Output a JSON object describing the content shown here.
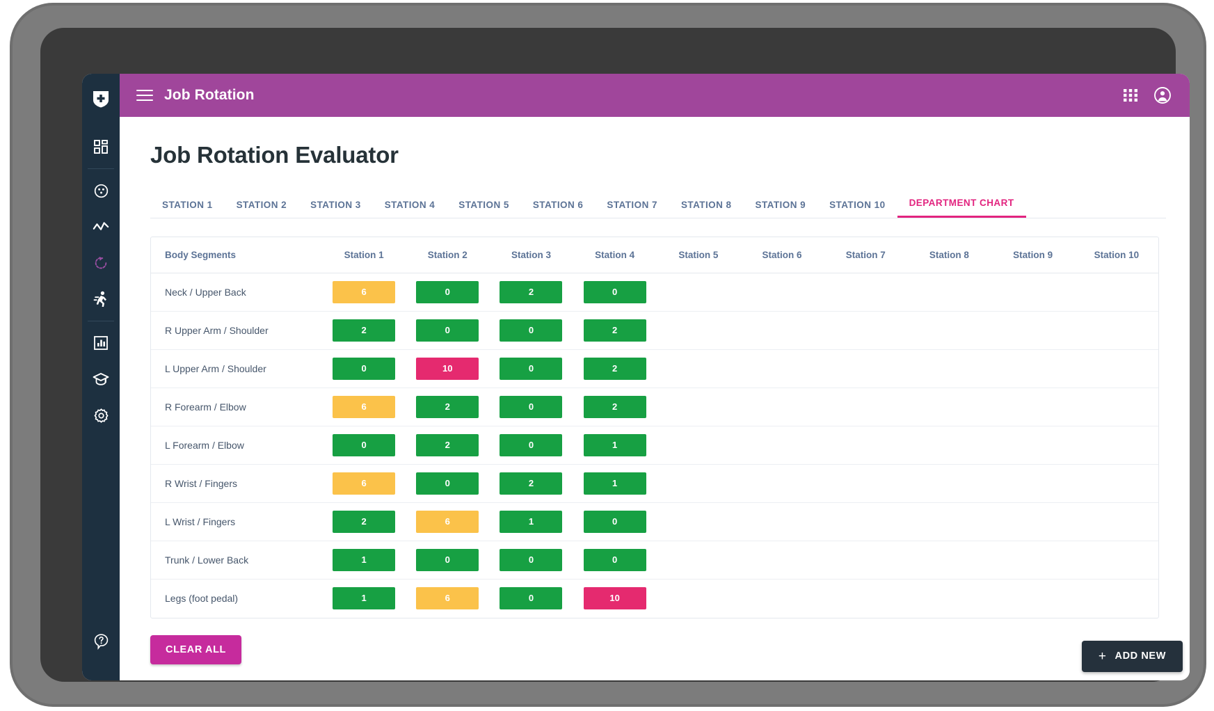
{
  "appbar": {
    "title": "Job Rotation",
    "menu_icon": "hamburger-menu-icon",
    "apps_icon": "apps-grid-icon",
    "account_icon": "account-circle-icon"
  },
  "sidebar": {
    "logo_icon": "shield-plus-logo-icon",
    "items": [
      {
        "icon": "dashboard-grid-icon",
        "name": "dashboard"
      },
      {
        "icon": "assessment-circle-icon",
        "name": "assessment"
      },
      {
        "icon": "trend-line-icon",
        "name": "trends"
      },
      {
        "icon": "rotation-refresh-icon",
        "name": "job-rotation",
        "active": true
      },
      {
        "icon": "running-person-icon",
        "name": "motion"
      },
      {
        "icon": "bar-chart-icon",
        "name": "reports"
      },
      {
        "icon": "graduation-cap-icon",
        "name": "training"
      },
      {
        "icon": "gear-icon",
        "name": "settings"
      }
    ],
    "help_icon": "help-question-icon"
  },
  "page": {
    "title": "Job Rotation Evaluator"
  },
  "tabs": [
    {
      "label": "STATION 1",
      "active": false
    },
    {
      "label": "STATION 2",
      "active": false
    },
    {
      "label": "STATION 3",
      "active": false
    },
    {
      "label": "STATION 4",
      "active": false
    },
    {
      "label": "STATION 5",
      "active": false
    },
    {
      "label": "STATION 6",
      "active": false
    },
    {
      "label": "STATION 7",
      "active": false
    },
    {
      "label": "STATION 8",
      "active": false
    },
    {
      "label": "STATION 9",
      "active": false
    },
    {
      "label": "STATION 10",
      "active": false
    },
    {
      "label": "DEPARTMENT CHART",
      "active": true
    }
  ],
  "table": {
    "columns": [
      "Body Segments",
      "Station 1",
      "Station 2",
      "Station 3",
      "Station 4",
      "Station 5",
      "Station 6",
      "Station 7",
      "Station 8",
      "Station 9",
      "Station 10"
    ],
    "rows": [
      {
        "segment": "Neck / Upper Back",
        "values": [
          {
            "value": "6",
            "level": "amber"
          },
          {
            "value": "0",
            "level": "green"
          },
          {
            "value": "2",
            "level": "green"
          },
          {
            "value": "0",
            "level": "green"
          },
          null,
          null,
          null,
          null,
          null,
          null
        ]
      },
      {
        "segment": "R Upper Arm / Shoulder",
        "values": [
          {
            "value": "2",
            "level": "green"
          },
          {
            "value": "0",
            "level": "green"
          },
          {
            "value": "0",
            "level": "green"
          },
          {
            "value": "2",
            "level": "green"
          },
          null,
          null,
          null,
          null,
          null,
          null
        ]
      },
      {
        "segment": "L Upper Arm / Shoulder",
        "values": [
          {
            "value": "0",
            "level": "green"
          },
          {
            "value": "10",
            "level": "pink"
          },
          {
            "value": "0",
            "level": "green"
          },
          {
            "value": "2",
            "level": "green"
          },
          null,
          null,
          null,
          null,
          null,
          null
        ]
      },
      {
        "segment": "R Forearm / Elbow",
        "values": [
          {
            "value": "6",
            "level": "amber"
          },
          {
            "value": "2",
            "level": "green"
          },
          {
            "value": "0",
            "level": "green"
          },
          {
            "value": "2",
            "level": "green"
          },
          null,
          null,
          null,
          null,
          null,
          null
        ]
      },
      {
        "segment": "L Forearm / Elbow",
        "values": [
          {
            "value": "0",
            "level": "green"
          },
          {
            "value": "2",
            "level": "green"
          },
          {
            "value": "0",
            "level": "green"
          },
          {
            "value": "1",
            "level": "green"
          },
          null,
          null,
          null,
          null,
          null,
          null
        ]
      },
      {
        "segment": "R Wrist / Fingers",
        "values": [
          {
            "value": "6",
            "level": "amber"
          },
          {
            "value": "0",
            "level": "green"
          },
          {
            "value": "2",
            "level": "green"
          },
          {
            "value": "1",
            "level": "green"
          },
          null,
          null,
          null,
          null,
          null,
          null
        ]
      },
      {
        "segment": "L Wrist / Fingers",
        "values": [
          {
            "value": "2",
            "level": "green"
          },
          {
            "value": "6",
            "level": "amber"
          },
          {
            "value": "1",
            "level": "green"
          },
          {
            "value": "0",
            "level": "green"
          },
          null,
          null,
          null,
          null,
          null,
          null
        ]
      },
      {
        "segment": "Trunk / Lower Back",
        "values": [
          {
            "value": "1",
            "level": "green"
          },
          {
            "value": "0",
            "level": "green"
          },
          {
            "value": "0",
            "level": "green"
          },
          {
            "value": "0",
            "level": "green"
          },
          null,
          null,
          null,
          null,
          null,
          null
        ]
      },
      {
        "segment": "Legs (foot pedal)",
        "values": [
          {
            "value": "1",
            "level": "green"
          },
          {
            "value": "6",
            "level": "amber"
          },
          {
            "value": "0",
            "level": "green"
          },
          {
            "value": "10",
            "level": "pink"
          },
          null,
          null,
          null,
          null,
          null,
          null
        ]
      }
    ]
  },
  "footer": {
    "clear_all_label": "CLEAR ALL",
    "add_new_label": "ADD NEW",
    "add_new_icon": "plus-icon"
  },
  "colors": {
    "brand_purple": "#a0469b",
    "accent_pink": "#e2247f",
    "clear_button": "#c62b9d",
    "sidebar": "#1d3040",
    "level_green": "#17a043",
    "level_amber": "#fbc24a",
    "level_pink": "#e52a6f",
    "header_text": "#5c7396"
  }
}
